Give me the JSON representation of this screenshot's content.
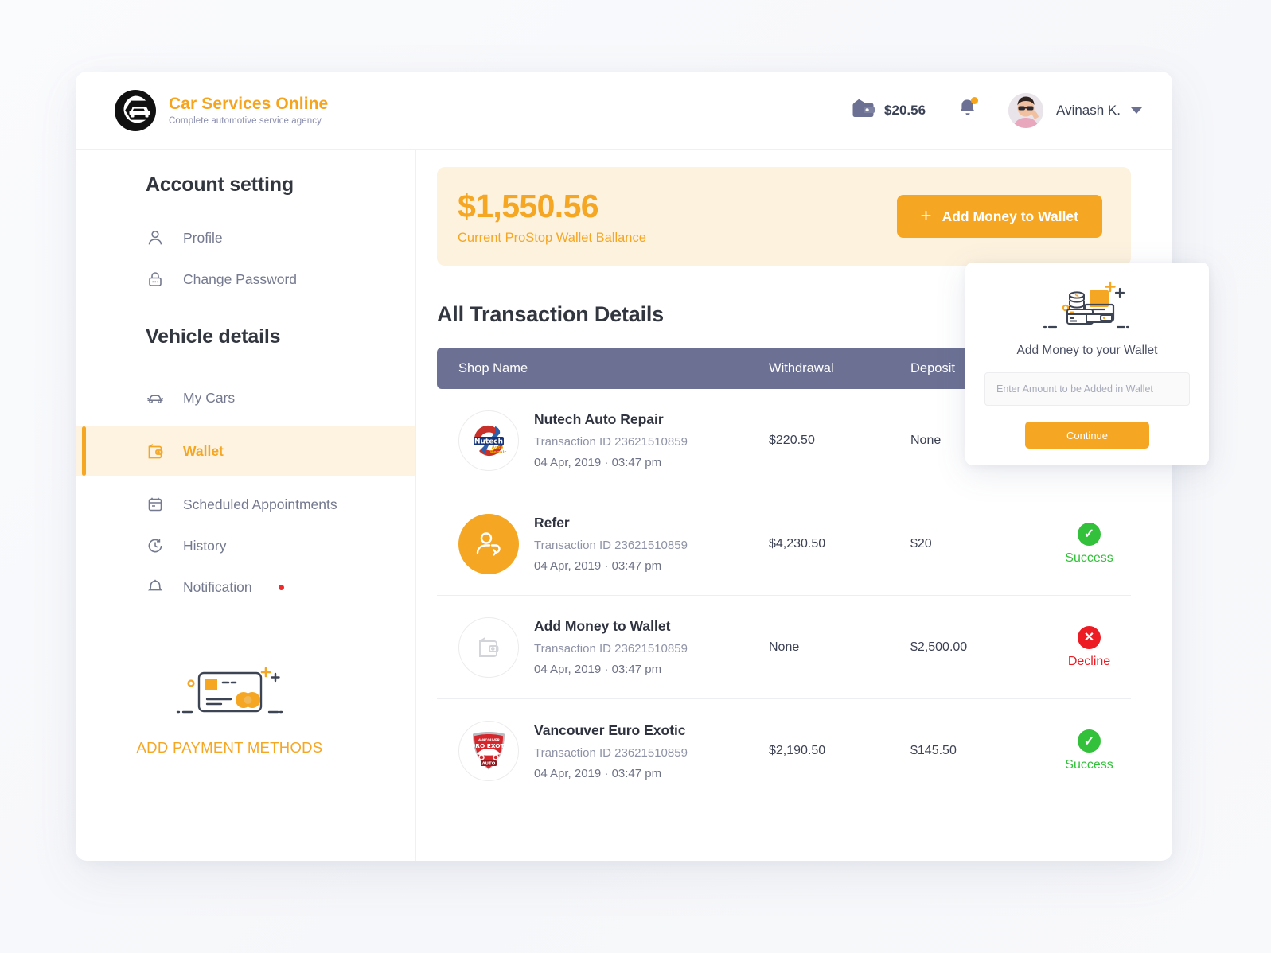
{
  "brand": {
    "title": "Car Services Online",
    "subtitle": "Complete automotive service agency"
  },
  "header": {
    "wallet_amount": "$20.56",
    "user_name": "Avinash K."
  },
  "sidebar": {
    "account_heading": "Account setting",
    "vehicle_heading": "Vehicle details",
    "account_items": [
      {
        "label": "Profile",
        "icon": "user-icon"
      },
      {
        "label": "Change Password",
        "icon": "lock-icon"
      }
    ],
    "vehicle_items": [
      {
        "label": "My Cars",
        "icon": "car-icon",
        "active": false
      },
      {
        "label": "Wallet",
        "icon": "wallet-icon",
        "active": true
      },
      {
        "label": "Scheduled Appointments",
        "icon": "calendar-icon",
        "active": false
      },
      {
        "label": "History",
        "icon": "clock-icon",
        "active": false
      },
      {
        "label": "Notification",
        "icon": "bell-icon",
        "active": false,
        "dot": true
      }
    ],
    "add_payment_label": "ADD PAYMENT METHODS"
  },
  "balance": {
    "amount": "$1,550.56",
    "caption": "Current ProStop Wallet Ballance",
    "button_label": "Add Money to Wallet",
    "button_plus": "+"
  },
  "transactions": {
    "title": "All Transaction Details",
    "columns": {
      "shop": "Shop Name",
      "withdrawal": "Withdrawal",
      "deposit": "Deposit",
      "status": ""
    },
    "rows": [
      {
        "name": "Nutech Auto Repair",
        "transaction_id": "Transaction ID 23621510859",
        "datetime": "04 Apr, 2019  ·  03:47 pm",
        "withdrawal": "$220.50",
        "deposit": "None",
        "status": "",
        "status_type": "none",
        "logo": "nutech-auto-repair-logo"
      },
      {
        "name": "Refer",
        "transaction_id": "Transaction ID 23621510859",
        "datetime": "04 Apr, 2019  ·  03:47 pm",
        "withdrawal": "$4,230.50",
        "deposit": "$20",
        "status": "Success",
        "status_type": "success",
        "logo": "refer-user-icon"
      },
      {
        "name": "Add Money to Wallet",
        "transaction_id": "Transaction ID 23621510859",
        "datetime": "04 Apr, 2019  ·  03:47 pm",
        "withdrawal": "None",
        "deposit": "$2,500.00",
        "status": "Decline",
        "status_type": "decline",
        "logo": "wallet-outline-icon"
      },
      {
        "name": "Vancouver Euro Exotic",
        "transaction_id": "Transaction ID 23621510859",
        "datetime": "04 Apr, 2019  ·  03:47 pm",
        "withdrawal": "$2,190.50",
        "deposit": "$145.50",
        "status": "Success",
        "status_type": "success",
        "logo": "vancouver-euro-exotic-logo"
      }
    ]
  },
  "popup": {
    "title": "Add Money to your Wallet",
    "input_placeholder": "Enter Amount to be Added in Wallet",
    "input_value": "",
    "button_label": "Continue"
  },
  "colors": {
    "accent": "#F5A623",
    "accent_soft": "#FDF2DE",
    "table_header": "#6C7194",
    "success": "#33C13B",
    "decline": "#ED1C24",
    "text_dark": "#32363f",
    "text_muted": "#8e92a6",
    "page_bg": "#f8f9fb"
  }
}
